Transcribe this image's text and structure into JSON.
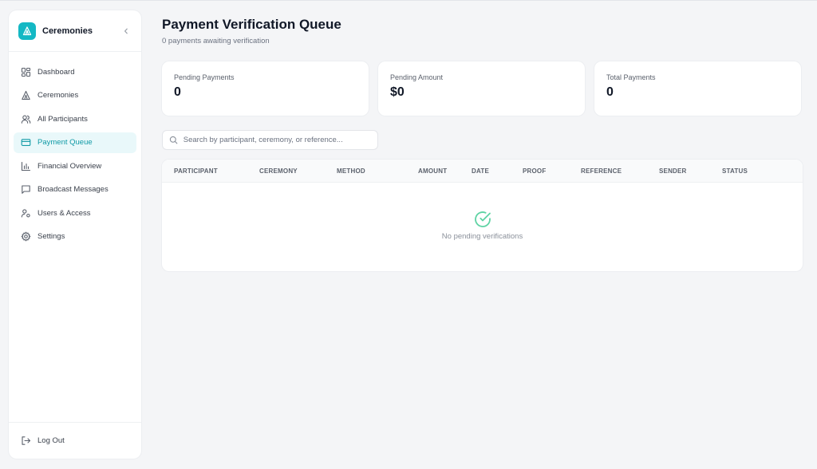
{
  "sidebar": {
    "brand_name": "Ceremonies",
    "items": [
      {
        "label": "Dashboard",
        "icon": "dashboard-icon"
      },
      {
        "label": "Ceremonies",
        "icon": "ceremonies-icon"
      },
      {
        "label": "All Participants",
        "icon": "participants-icon"
      },
      {
        "label": "Payment Queue",
        "icon": "credit-card-icon",
        "active": true
      },
      {
        "label": "Financial Overview",
        "icon": "bar-chart-icon"
      },
      {
        "label": "Broadcast Messages",
        "icon": "message-icon"
      },
      {
        "label": "Users & Access",
        "icon": "user-key-icon"
      },
      {
        "label": "Settings",
        "icon": "gear-icon"
      }
    ],
    "logout_label": "Log Out"
  },
  "header": {
    "title": "Payment Verification Queue",
    "subtitle": "0 payments awaiting verification"
  },
  "stats": [
    {
      "label": "Pending Payments",
      "value": "0"
    },
    {
      "label": "Pending Amount",
      "value": "$0"
    },
    {
      "label": "Total Payments",
      "value": "0"
    }
  ],
  "search": {
    "placeholder": "Search by participant, ceremony, or reference...",
    "value": ""
  },
  "table": {
    "columns": [
      "PARTICIPANT",
      "CEREMONY",
      "METHOD",
      "AMOUNT",
      "DATE",
      "PROOF",
      "REFERENCE",
      "SENDER",
      "STATUS"
    ],
    "rows": [],
    "empty_text": "No pending verifications"
  },
  "colors": {
    "accent": "#14b8c4",
    "active_bg": "#e9f8fa",
    "success": "#5fd3a4"
  }
}
